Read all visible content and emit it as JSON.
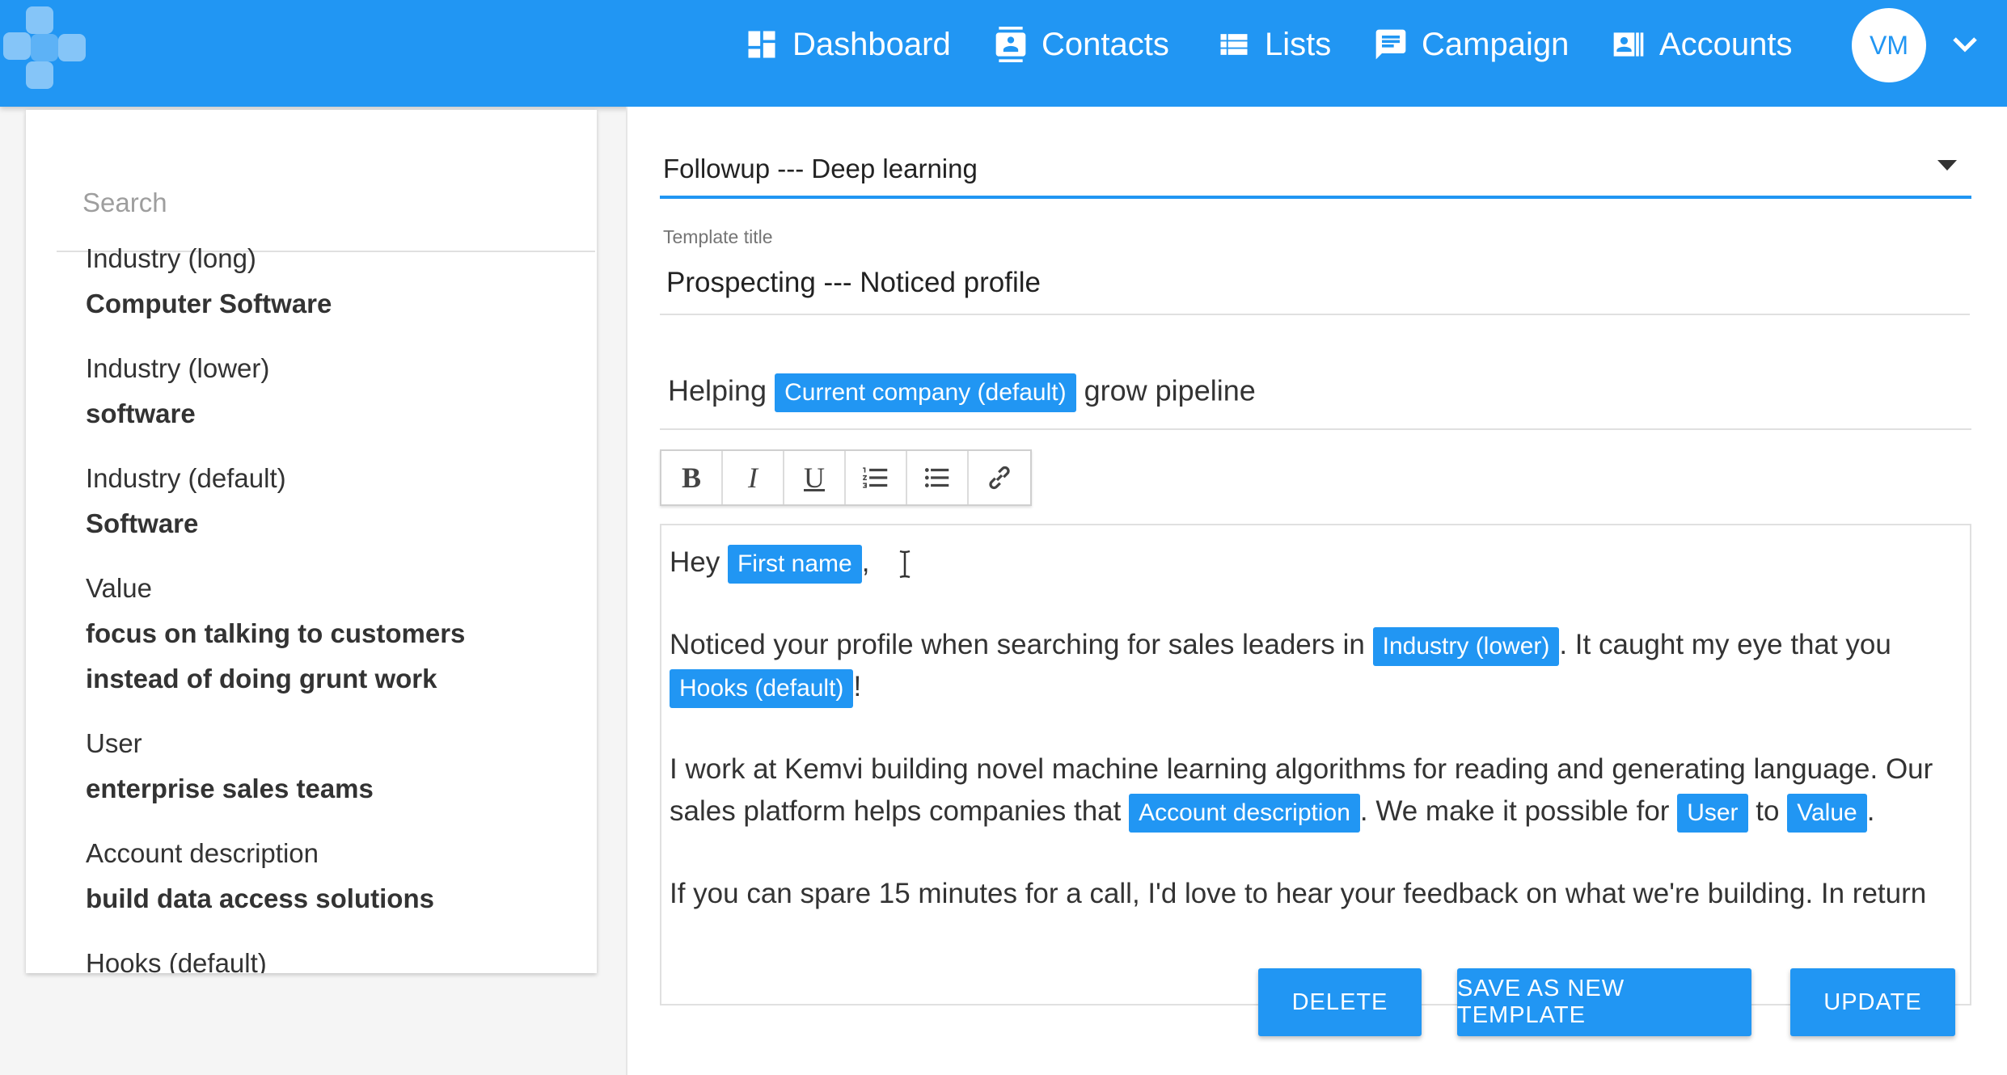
{
  "header": {
    "nav": [
      {
        "label": "Dashboard",
        "icon": "dashboard-icon"
      },
      {
        "label": "Contacts",
        "icon": "contacts-icon"
      },
      {
        "label": "Lists",
        "icon": "list-icon"
      },
      {
        "label": "Campaign",
        "icon": "chat-icon"
      },
      {
        "label": "Accounts",
        "icon": "accounts-icon"
      }
    ],
    "avatar_initials": "VM"
  },
  "sidebar": {
    "search_placeholder": "Search",
    "variables": [
      {
        "label": "Industry (long)",
        "value": "Computer Software"
      },
      {
        "label": "Industry (lower)",
        "value": "software"
      },
      {
        "label": "Industry (default)",
        "value": "Software"
      },
      {
        "label": "Value",
        "value": "focus on talking to customers instead of doing grunt work"
      },
      {
        "label": "User",
        "value": "enterprise sales teams"
      },
      {
        "label": "Account description",
        "value": "build data access solutions"
      },
      {
        "label": "Hooks (default)",
        "value": ""
      }
    ]
  },
  "main": {
    "template_select": "Followup --- Deep learning",
    "template_title_label": "Template title",
    "template_title": "Prospecting --- Noticed profile",
    "subject": {
      "before": "Helping",
      "chip": "Current company (default)",
      "after": "grow pipeline"
    },
    "toolbar": [
      "B",
      "I",
      "U",
      "ordered-list",
      "bullet-list",
      "link"
    ],
    "body": {
      "p1_text": "Hey",
      "p1_chip": "First name",
      "p1_after": ",",
      "p2_text": "Noticed your profile when searching for sales leaders in",
      "p2_chip1": "Industry (lower)",
      "p2_mid": ". It caught my eye that you",
      "p2_chip2": "Hooks (default)",
      "p2_end": "!",
      "p3_text": "I work at Kemvi building novel machine learning algorithms for reading and generating language. Our sales platform helps companies that",
      "p3_chip1": "Account description",
      "p3_mid": ". We make it possible for",
      "p3_chip2": "User",
      "p3_to": "to",
      "p3_chip3": "Value",
      "p3_end": ".",
      "p4_text": "If you can spare 15 minutes for a call, I'd love to hear your feedback on what we're building. In return"
    },
    "buttons": {
      "delete": "DELETE",
      "save_new": "SAVE AS NEW TEMPLATE",
      "update": "UPDATE"
    }
  },
  "colors": {
    "accent": "#2196f3"
  }
}
